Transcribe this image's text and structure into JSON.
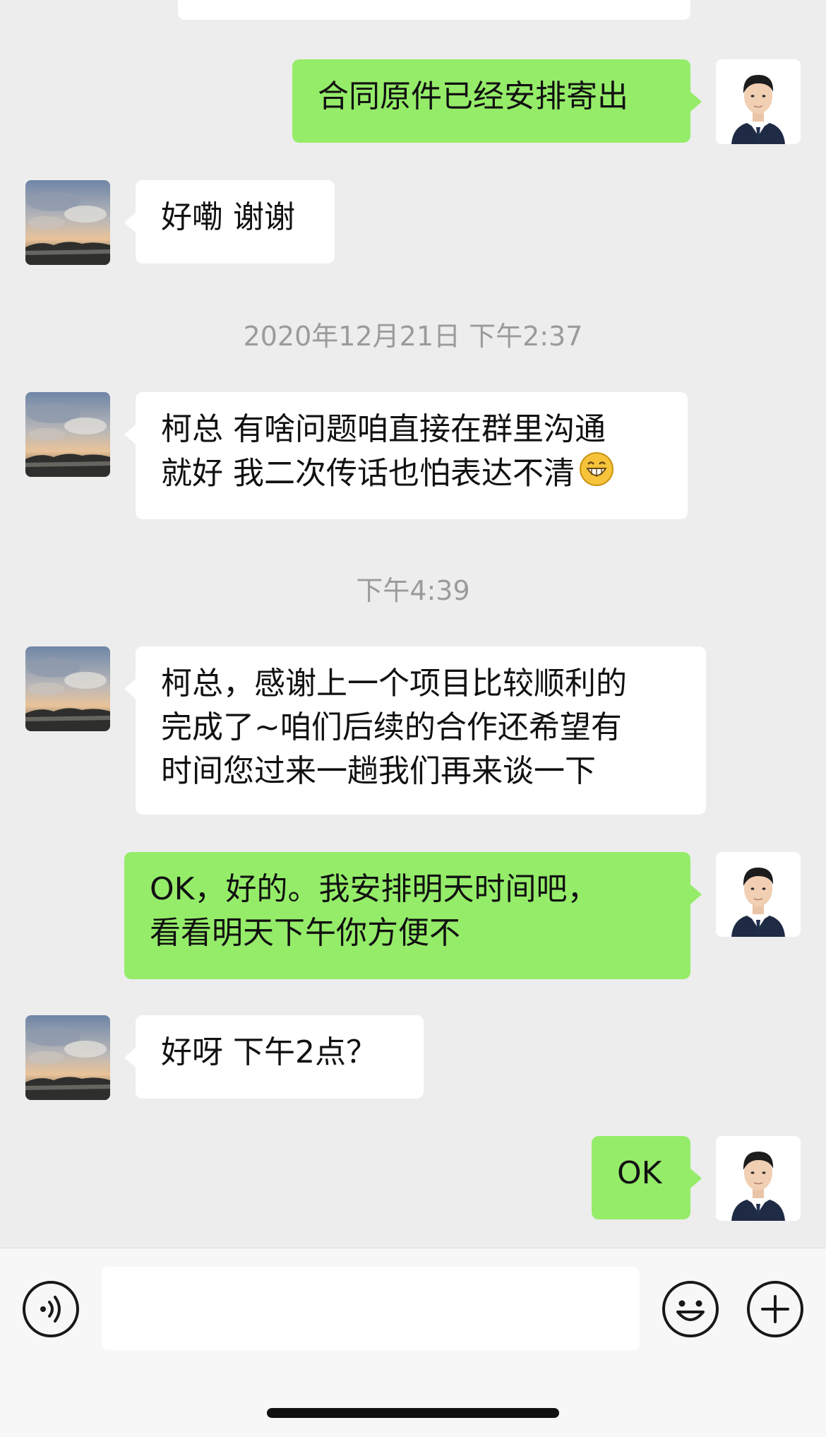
{
  "messages": [
    {
      "id": "m1",
      "text": "合同原件已经安排寄出"
    },
    {
      "id": "m2",
      "text": "好嘞 谢谢"
    },
    {
      "id": "t1",
      "text": "2020年12月21日 下午2:37"
    },
    {
      "id": "m3",
      "line1": "柯总 有啥问题咱直接在群里沟通",
      "line2": "就好 我二次传话也怕表达不清"
    },
    {
      "id": "t2",
      "text": "下午4:39"
    },
    {
      "id": "m4",
      "line1": "柯总，感谢上一个项目比较顺利的",
      "line2": "完成了~咱们后续的合作还希望有",
      "line3": "时间您过来一趟我们再来谈一下"
    },
    {
      "id": "m5",
      "line1": "OK，好的。我安排明天时间吧，",
      "line2": "看看明天下午你方便不"
    },
    {
      "id": "m6",
      "text": "好呀 下午2点？"
    },
    {
      "id": "m7",
      "text": "OK"
    }
  ],
  "icons": {
    "inline_emoji": "grinning-face-emoji",
    "voice": "voice-icon",
    "emoji": "emoji-icon",
    "plus": "plus-icon"
  },
  "colors": {
    "background": "#ededed",
    "outgoing_bubble": "#95ec69",
    "incoming_bubble": "#ffffff",
    "timestamp": "#9b9b9b"
  }
}
